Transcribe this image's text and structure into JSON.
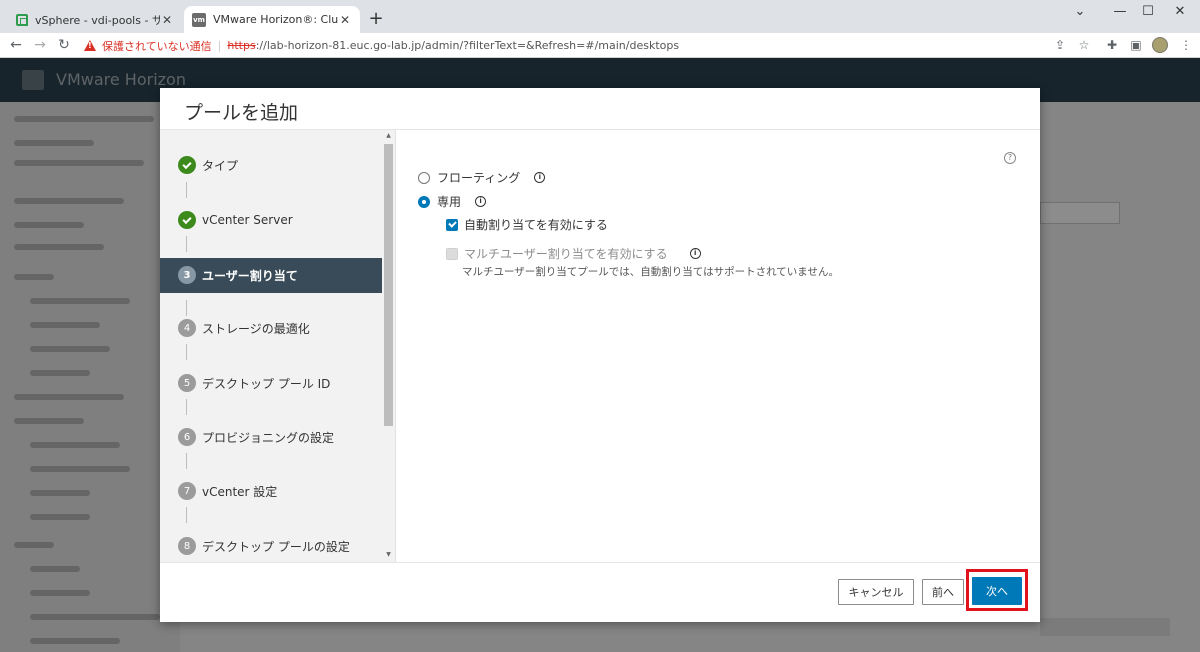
{
  "browser": {
    "tabs": [
      {
        "title": "vSphere - vdi-pools - サマリ",
        "icon": "vsphere-icon"
      },
      {
        "title": "VMware Horizon®: Cluster-LAB-",
        "icon": "vm-icon"
      }
    ],
    "new_tab": "+",
    "address": {
      "warning": "保護されていない通信",
      "separator": "|",
      "scheme": "https",
      "rest": "://lab-horizon-81.euc.go-lab.jp/admin/?filterText=&Refresh=#/main/desktops"
    }
  },
  "app": {
    "title": "VMware Horizon"
  },
  "dialog": {
    "title": "プールを追加",
    "steps": [
      {
        "num": "",
        "label": "タイプ",
        "state": "done"
      },
      {
        "num": "",
        "label": "vCenter Server",
        "state": "done"
      },
      {
        "num": "3",
        "label": "ユーザー割り当て",
        "state": "active"
      },
      {
        "num": "4",
        "label": "ストレージの最適化",
        "state": "pending"
      },
      {
        "num": "5",
        "label": "デスクトップ プール ID",
        "state": "pending"
      },
      {
        "num": "6",
        "label": "プロビジョニングの設定",
        "state": "pending"
      },
      {
        "num": "7",
        "label": "vCenter 設定",
        "state": "pending"
      },
      {
        "num": "8",
        "label": "デスクトップ プールの設定",
        "state": "pending"
      }
    ],
    "options": {
      "floating_label": "フローティング",
      "dedicated_label": "専用",
      "auto_assign_label": "自動割り当てを有効にする",
      "multi_user_label": "マルチユーザー割り当てを有効にする",
      "multi_user_note": "マルチユーザー割り当てプールでは、自動割り当てはサポートされていません。",
      "selected": "dedicated",
      "auto_assign_checked": true,
      "multi_user_checked": false
    },
    "buttons": {
      "cancel": "キャンセル",
      "back": "前へ",
      "next": "次へ"
    },
    "colors": {
      "primary": "#0079b8",
      "done": "#3c8a1c",
      "active_step_bg": "#394b58",
      "highlight": "#e0121c"
    }
  }
}
